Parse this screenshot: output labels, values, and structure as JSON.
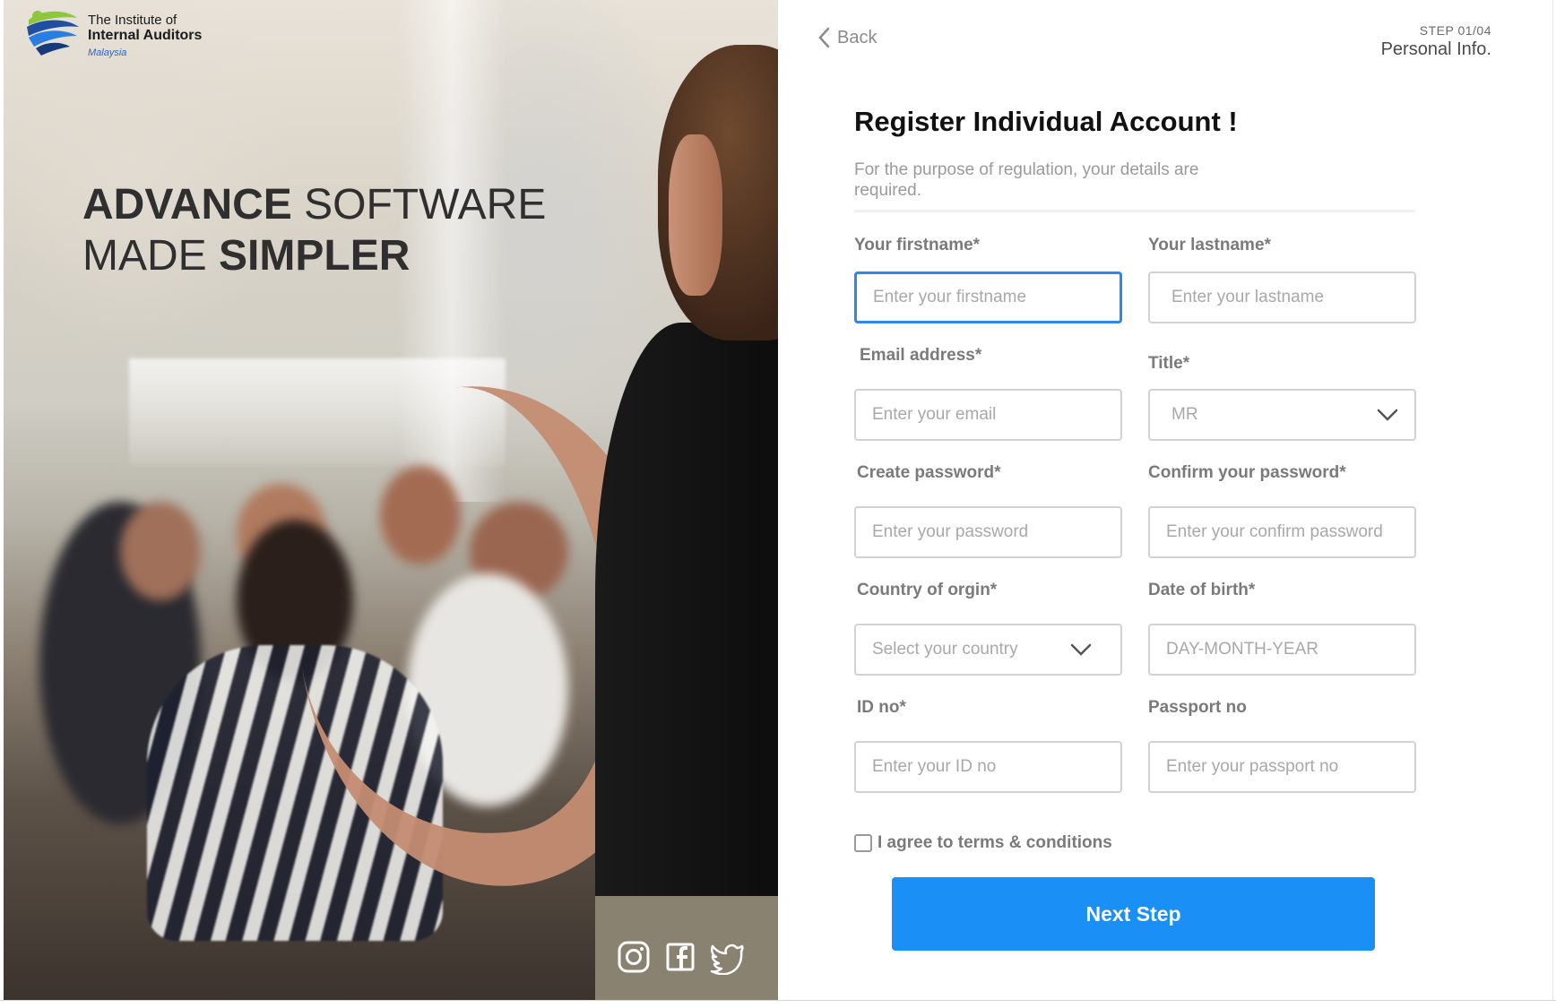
{
  "brand": {
    "line1": "The Institute of",
    "line2": "Internal Auditors",
    "line3": "Malaysia"
  },
  "hero": {
    "tag_part1_bold": "ADVANCE",
    "tag_part1_rest": " SOFTWARE",
    "tag_part2_rest": "MADE ",
    "tag_part2_bold": "SIMPLER"
  },
  "socials": [
    "instagram-icon",
    "facebook-icon",
    "twitter-icon"
  ],
  "nav": {
    "back_label": "Back"
  },
  "step": {
    "number": "STEP 01/04",
    "name": "Personal Info."
  },
  "form": {
    "title": "Register Individual Account !",
    "subtitle": "For the purpose of  regulation, your details are required.",
    "firstname": {
      "label": "Your firstname*",
      "placeholder": "Enter your firstname"
    },
    "lastname": {
      "label": "Your lastname*",
      "placeholder": "Enter your lastname"
    },
    "email": {
      "label": "Email address*",
      "placeholder": "Enter your email"
    },
    "title_field": {
      "label": "Title*",
      "value": "MR"
    },
    "password": {
      "label": "Create password*",
      "placeholder": "Enter your password"
    },
    "confirm_password": {
      "label": "Confirm your password*",
      "placeholder": "Enter your confirm password"
    },
    "country": {
      "label": "Country of orgin*",
      "value": "Select your country"
    },
    "dob": {
      "label": "Date of birth*",
      "placeholder": "DAY-MONTH-YEAR"
    },
    "id_no": {
      "label": "ID no*",
      "placeholder": "Enter your ID no"
    },
    "passport": {
      "label": "Passport no",
      "placeholder": "Enter your passport no"
    },
    "agree_label": "I agree to terms & conditions",
    "submit_label": "Next Step"
  },
  "colors": {
    "primary": "#1a8ff5",
    "focus_border": "#2d88e8",
    "label": "#7a7a7a"
  }
}
